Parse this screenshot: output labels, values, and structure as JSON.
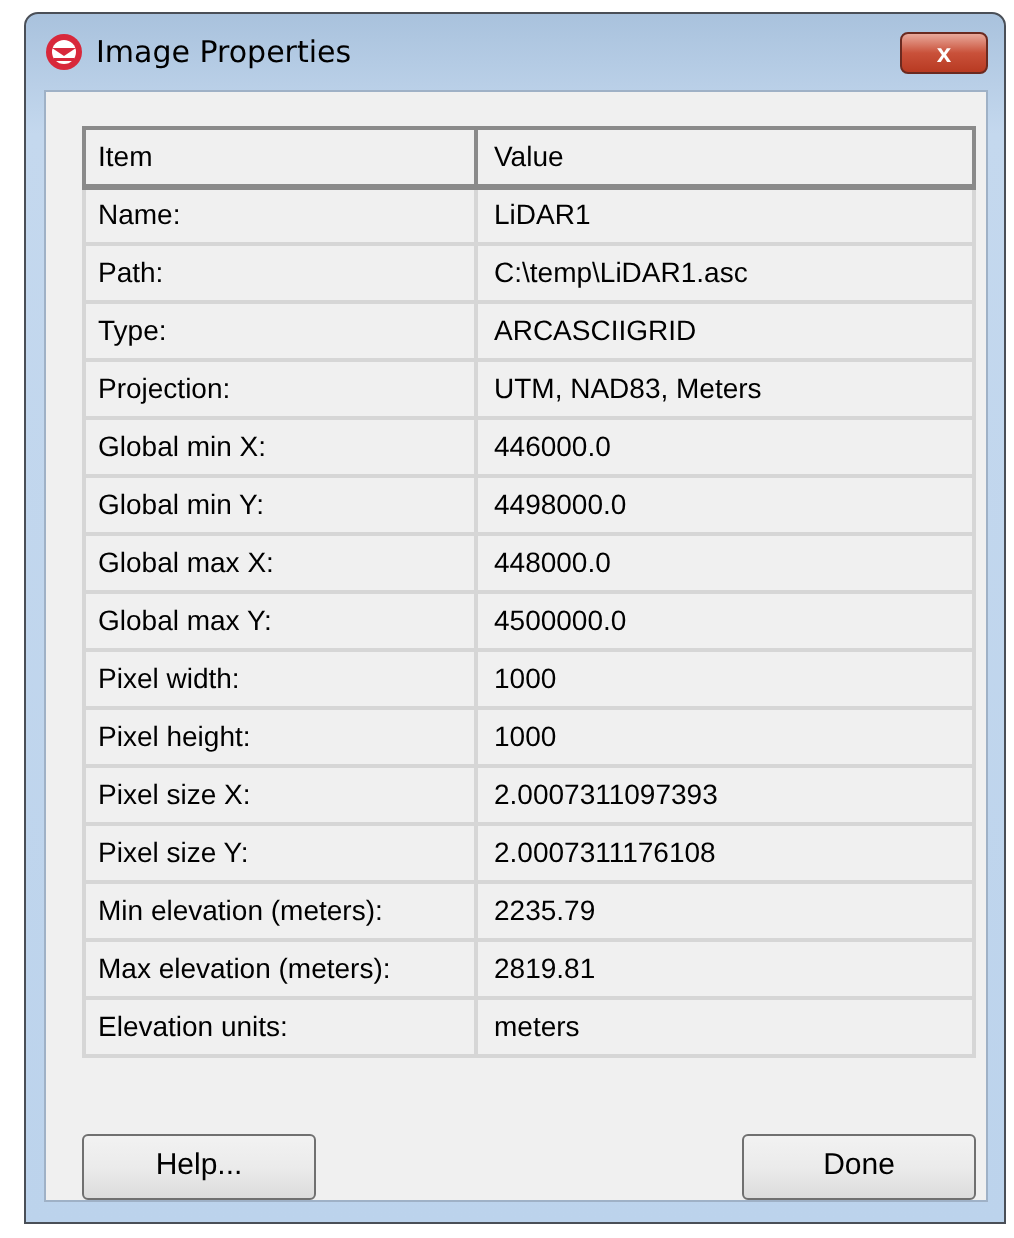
{
  "window": {
    "title": "Image Properties",
    "close": "x"
  },
  "table": {
    "columns": [
      "Item",
      "Value"
    ],
    "rows": [
      [
        "Name:",
        "LiDAR1"
      ],
      [
        "Path:",
        "C:\\temp\\LiDAR1.asc"
      ],
      [
        "Type:",
        "ARCASCIIGRID"
      ],
      [
        "Projection:",
        "UTM, NAD83, Meters"
      ],
      [
        "Global min X:",
        "446000.0"
      ],
      [
        "Global min Y:",
        "4498000.0"
      ],
      [
        "Global max X:",
        "448000.0"
      ],
      [
        "Global max Y:",
        "4500000.0"
      ],
      [
        "Pixel width:",
        "1000"
      ],
      [
        "Pixel height:",
        "1000"
      ],
      [
        "Pixel size X:",
        "2.0007311097393"
      ],
      [
        "Pixel size Y:",
        "2.0007311176108"
      ],
      [
        "Min elevation (meters):",
        "2235.79"
      ],
      [
        "Max elevation (meters):",
        "2819.81"
      ],
      [
        "Elevation units:",
        "meters"
      ]
    ]
  },
  "buttons": [
    "Help...",
    "Done"
  ]
}
